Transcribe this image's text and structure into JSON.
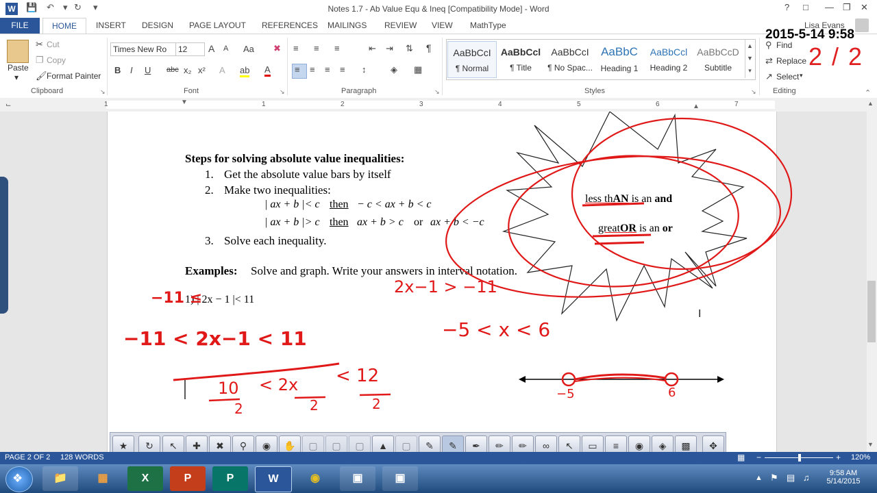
{
  "window": {
    "title": "Notes 1.7 - Ab Value Equ & Ineq [Compatibility Mode] - Word",
    "help": "?",
    "user": "Lisa Evans"
  },
  "tabs": [
    "FILE",
    "HOME",
    "INSERT",
    "DESIGN",
    "PAGE LAYOUT",
    "REFERENCES",
    "MAILINGS",
    "REVIEW",
    "VIEW",
    "MathType"
  ],
  "clipboard": {
    "paste": "Paste",
    "cut": "Cut",
    "copy": "Copy",
    "format_painter": "Format Painter",
    "label": "Clipboard"
  },
  "font": {
    "name": "Times New Ro",
    "size": "12",
    "label": "Font",
    "grow": "A",
    "shrink": "A",
    "case": "Aa",
    "bold": "B",
    "italic": "I",
    "underline": "U",
    "strike": "abc",
    "sub": "x₂",
    "sup": "x²",
    "effects": "A",
    "highlight": "ab",
    "color": "A"
  },
  "paragraph": {
    "label": "Paragraph",
    "pilcrow": "¶"
  },
  "styles": {
    "label": "Styles",
    "items": [
      {
        "sample": "AaBbCcI",
        "name": "¶ Normal"
      },
      {
        "sample": "AaBbCcl",
        "name": "¶ Title"
      },
      {
        "sample": "AaBbCcI",
        "name": "¶ No Spac..."
      },
      {
        "sample": "AaBbC",
        "name": "Heading 1"
      },
      {
        "sample": "AaBbCcl",
        "name": "Heading 2"
      },
      {
        "sample": "AaBbCcD",
        "name": "Subtitle"
      }
    ]
  },
  "editing": {
    "find": "Find",
    "replace": "Replace",
    "select": "Select",
    "label": "Editing"
  },
  "ruler": [
    "1",
    "1",
    "2",
    "3",
    "4",
    "5",
    "6",
    "7"
  ],
  "stamp": {
    "date": "2015-5-14   9:58",
    "page": "2 / 2"
  },
  "document": {
    "heading": "Steps for solving absolute value inequalities:",
    "steps": [
      "Get the absolute value bars by itself",
      "Make two inequalities:",
      "Solve each inequality."
    ],
    "step_nums": [
      "1.",
      "2.",
      "3."
    ],
    "rule_less": {
      "expr": "| ax + b |< c",
      "then": "then",
      "result": "− c < ax + b < c"
    },
    "rule_greater": {
      "expr": "| ax + b |> c",
      "then": "then",
      "result": "ax + b > c",
      "or": "or",
      "result2": "ax + b < −c"
    },
    "examples_label": "Examples:",
    "examples_text": "Solve and graph.  Write your answers in interval notation.",
    "problem": "1)  | 2x − 1 |< 11",
    "bubble": {
      "less": "less th",
      "less_bold": "AN",
      "less_tail": " is an ",
      "less_and": "and",
      "great": "great",
      "great_bold": "OR",
      "great_tail": " is an ",
      "great_or": "or"
    },
    "handwriting": {
      "h1": "−11 ≤",
      "h2": "2x−1 > −11",
      "h3": "−11 < 2x−1 < 11",
      "h4": "−5 < x < 6",
      "h5": "10",
      "h6": "< 2x",
      "h7": "< 12",
      "h8": "2",
      "h9": "2",
      "h10": "2",
      "h11": "−5",
      "h12": "6"
    }
  },
  "status": {
    "page": "PAGE 2 OF 2",
    "words": "128 WORDS",
    "zoom": "120%"
  },
  "taskbar": {
    "time": "9:58 AM",
    "date": "5/14/2015"
  }
}
